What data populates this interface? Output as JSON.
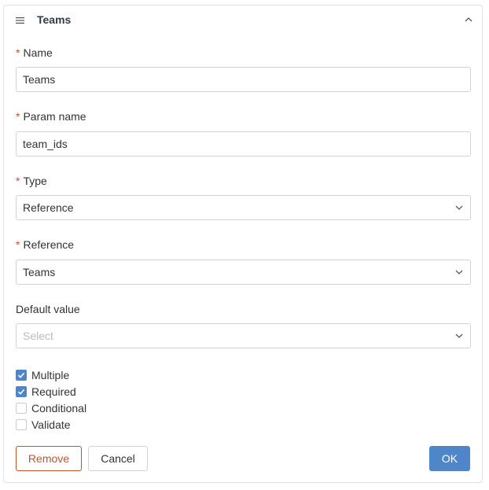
{
  "header": {
    "title": "Teams",
    "menu_icon": "hamburger-menu-icon",
    "collapse_icon": "chevron-up-icon"
  },
  "fields": {
    "name": {
      "label": "Name",
      "required": true,
      "value": "Teams"
    },
    "param_name": {
      "label": "Param name",
      "required": true,
      "value": "team_ids"
    },
    "type": {
      "label": "Type",
      "required": true,
      "value": "Reference"
    },
    "reference": {
      "label": "Reference",
      "required": true,
      "value": "Teams"
    },
    "default_value": {
      "label": "Default value",
      "required": false,
      "placeholder": "Select"
    }
  },
  "required_mark": "*",
  "options": [
    {
      "label": "Multiple",
      "checked": true
    },
    {
      "label": "Required",
      "checked": true
    },
    {
      "label": "Conditional",
      "checked": false
    },
    {
      "label": "Validate",
      "checked": false
    }
  ],
  "buttons": {
    "remove": "Remove",
    "cancel": "Cancel",
    "ok": "OK"
  },
  "colors": {
    "accent": "#4f86c9",
    "danger": "#c7522a",
    "border": "#d0d4d9"
  }
}
